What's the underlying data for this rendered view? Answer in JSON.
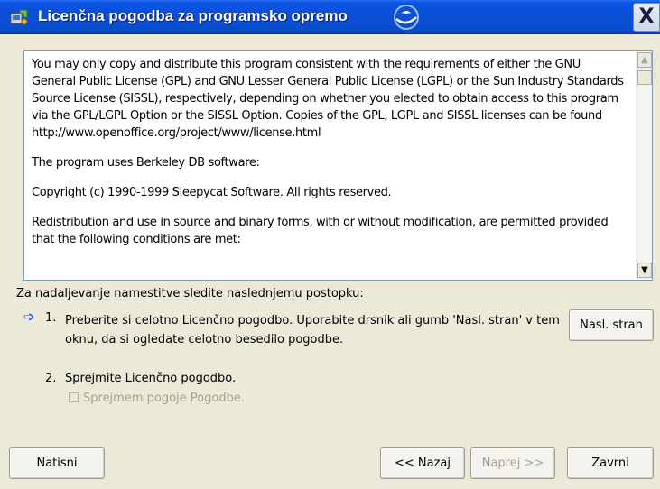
{
  "window": {
    "title": "Licenčna pogodba za programsko opremo",
    "close_glyph": "X"
  },
  "license_text": {
    "paragraphs": [
      "You may only copy and distribute this program consistent with the requirements of either the GNU General Public License (GPL) and GNU Lesser General Public License (LGPL) or the Sun Industry Standards Source License (SISSL), respectively, depending on whether you elected to obtain access to this program via the GPL/LGPL Option or the SISSL Option. Copies of the GPL, LGPL and SISSL licenses can be found http://www.openoffice.org/project/www/license.html",
      "The program uses Berkeley DB software:",
      "Copyright (c) 1990-1999 Sleepycat Software.  All rights reserved.",
      "Redistribution and use in source and binary forms, with or without modification, are permitted provided that the following conditions are met:"
    ]
  },
  "instructions": {
    "heading": "Za nadaljevanje namestitve sledite naslednjemu postopku:",
    "step1_number": "1.",
    "step1_text": "Preberite si celotno Licenčno pogodbo. Uporabite drsnik ali gumb 'Nasl. stran' v tem oknu, da si ogledate celotno besedilo pogodbe.",
    "step2_number": "2.",
    "step2_text": "Sprejmite Licenčno pogodbo.",
    "accept_checkbox_label": "Sprejmem pogoje Pogodbe.",
    "accept_checked": false
  },
  "buttons": {
    "next_page": "Nasl. stran",
    "print": "Natisni",
    "back": "<< Nazaj",
    "next": "Naprej >>",
    "cancel": "Zavrni"
  },
  "icons": {
    "title_icon": "installer-icon",
    "logo": "openoffice-gull-logo",
    "step_pointer": "arrow-right-icon"
  },
  "colors": {
    "titlebar": "#0a4fd8",
    "dialog_bg": "#ece9d8",
    "disabled_text": "#a5a294"
  }
}
